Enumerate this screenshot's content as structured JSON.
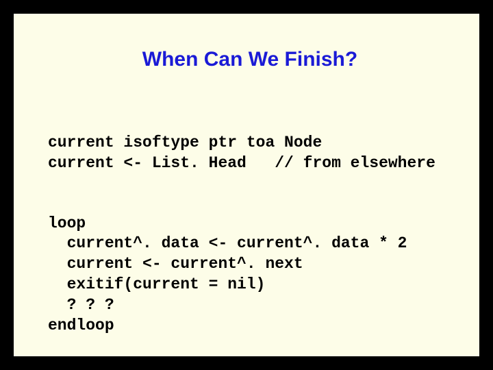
{
  "slide": {
    "title": "When Can We Finish?",
    "code": {
      "decl_line1": "current isoftype ptr toa Node",
      "decl_line2": "current <- List. Head   // from elsewhere",
      "loop_open": "loop",
      "body1": "  current^. data <- current^. data * 2",
      "body2": "  current <- current^. next",
      "body3": "  exitif(current = nil)",
      "body4": "  ? ? ?",
      "loop_close": "endloop"
    }
  }
}
